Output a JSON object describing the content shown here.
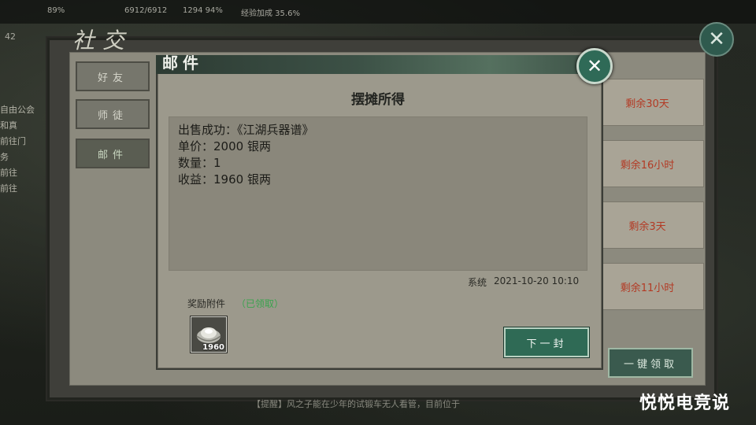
{
  "hud": {
    "stats": [
      "89%",
      "6912/6912",
      "1294 94%",
      "经验加成 35.6%"
    ],
    "level": "42"
  },
  "social_panel": {
    "title": "社交",
    "tabs": [
      {
        "label": "好友"
      },
      {
        "label": "师徒"
      },
      {
        "label": "邮件"
      }
    ],
    "right_cards": [
      "剩余30天",
      "剩余16小时",
      "剩余3天",
      "剩余11小时"
    ],
    "claim_all_label": "一键领取"
  },
  "left_strip": [
    "自由公会",
    "和真",
    "前往门",
    "务",
    "前往",
    "前往"
  ],
  "bottom_text": "【提醒】风之子能在少年的试锻车无人看管，目前位于",
  "mail_dialog": {
    "tab_label": "邮件",
    "close_glyph": "✕",
    "subject": "摆摊所得",
    "body_lines": [
      "出售成功：《江湖兵器谱》",
      "单价：2000 银两",
      "数量：1",
      "收益：1960 银两"
    ],
    "sender": "系统",
    "timestamp": "2021-10-20 10:10",
    "attachment_label": "奖励附件",
    "attachment_status": "（已领取）",
    "attachment_item": {
      "icon": "silver-ingot-icon",
      "quantity": "1960"
    },
    "next_button_label": "下一封"
  },
  "watermark": "悦悦电竞说",
  "colors": {
    "accent_green": "#2f6a55",
    "claimed_green": "#3aa34e",
    "panel_beige": "#9c998c"
  }
}
